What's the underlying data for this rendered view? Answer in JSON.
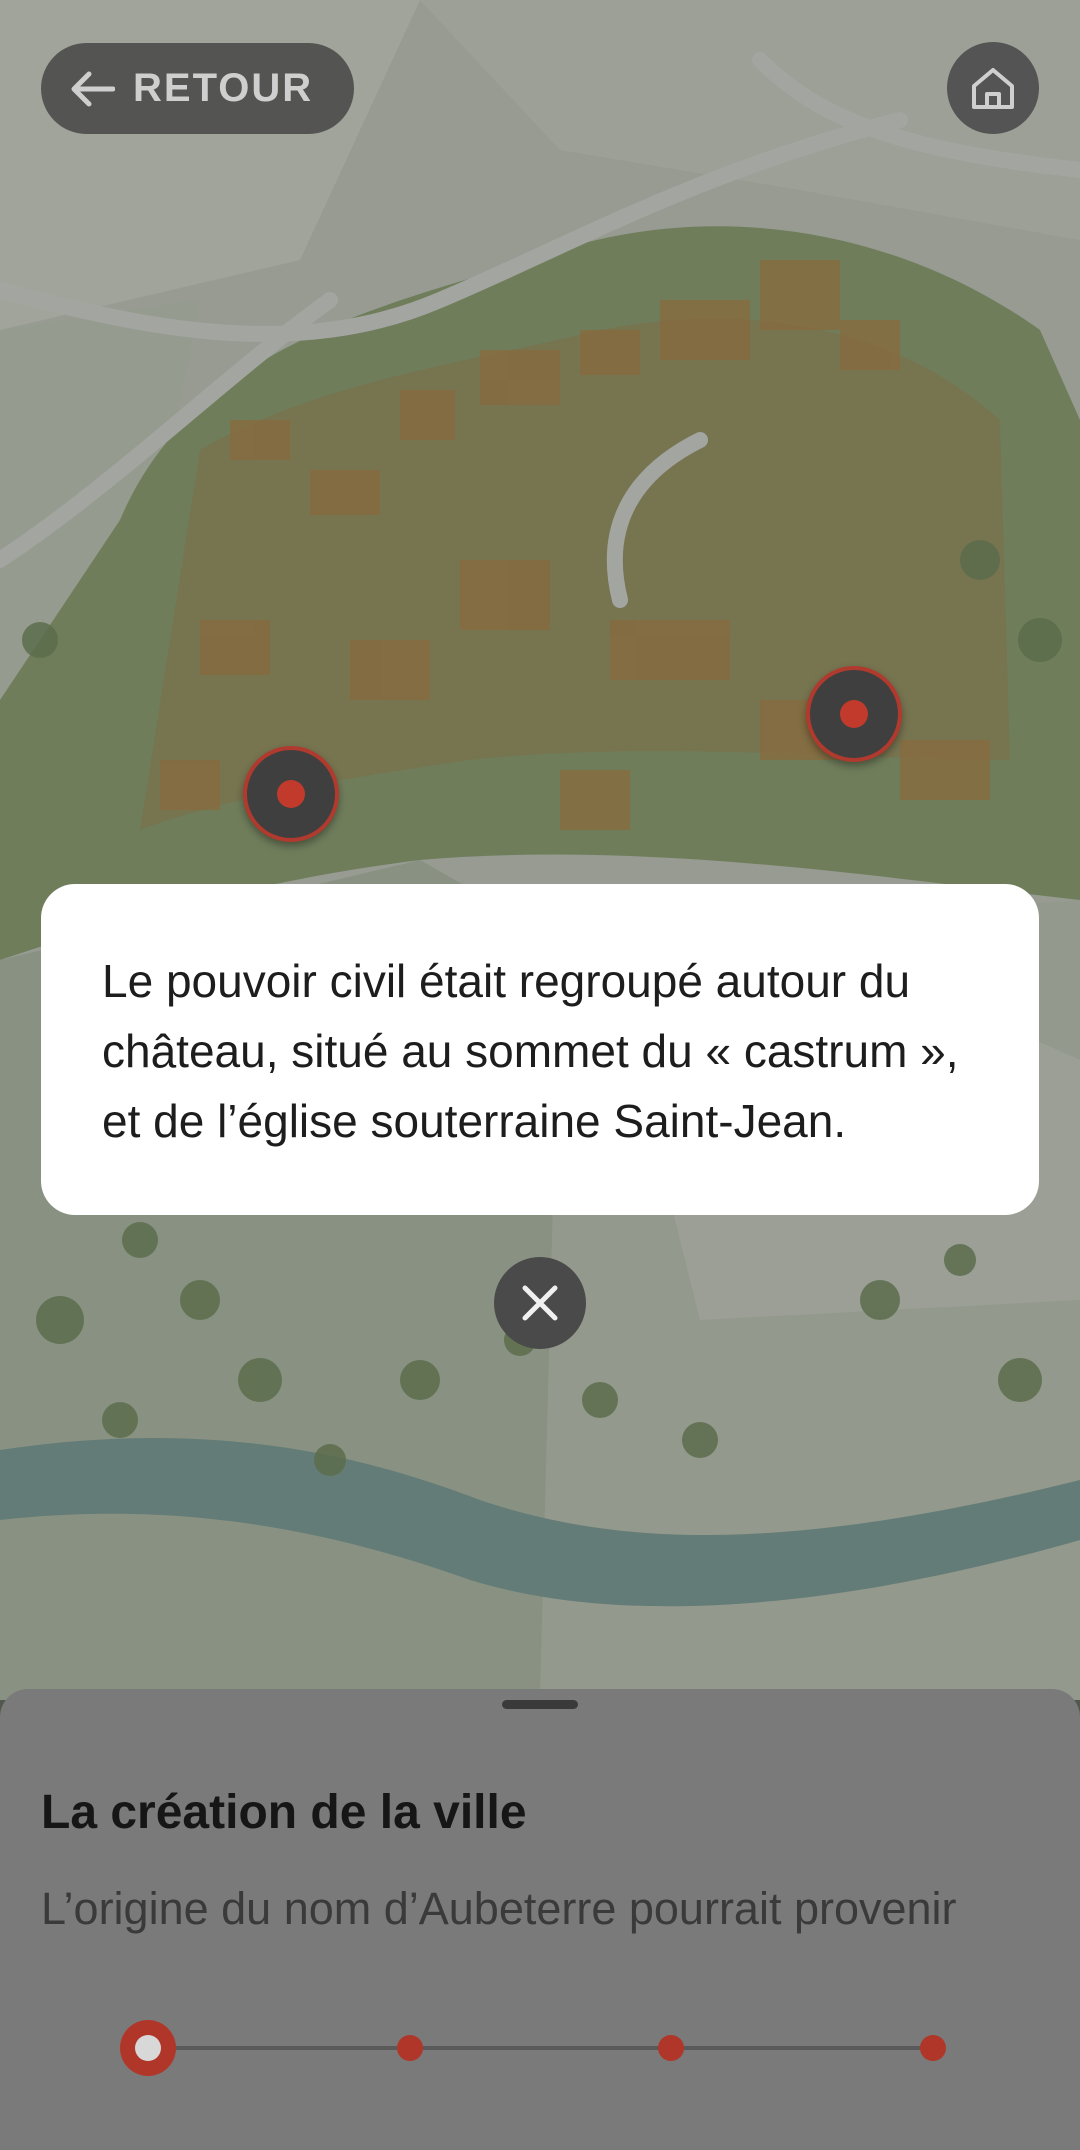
{
  "header": {
    "back_label": "RETOUR",
    "back_icon": "arrow-left-icon",
    "home_icon": "home-icon"
  },
  "map": {
    "markers": [
      {
        "name": "map-marker-west"
      },
      {
        "name": "map-marker-east"
      }
    ]
  },
  "popup": {
    "text": "Le pouvoir civil était regroupé autour du château, situé au sommet du « castrum », et de l’église souterraine Saint-Jean.",
    "close_icon": "close-icon"
  },
  "sheet": {
    "title": "La création de la ville",
    "text": "L’origine du nom d’Aubeterre pourrait provenir",
    "timeline_steps": 4,
    "active_step": 1
  },
  "colors": {
    "accent": "#c23a2c",
    "map_green": "#9fb894",
    "overlay_button": "#4a4a4a"
  }
}
